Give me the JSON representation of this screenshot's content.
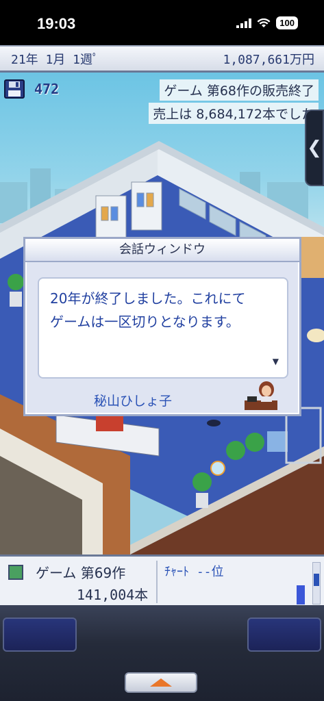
{
  "status_bar": {
    "time": "19:03",
    "battery": "100"
  },
  "info_bar": {
    "date": "21年 1月 1週ﾟ",
    "money": "1,087,661万円"
  },
  "save": {
    "icon": "floppy-disk-icon",
    "count": "472"
  },
  "news": {
    "line1": "ゲーム 第68作の販売終了",
    "line2": "売上は 8,684,172本でした"
  },
  "dialog": {
    "title": "会話ウィンドウ",
    "message_line1": "20年が終了しました。これにて",
    "message_line2": "ゲームは一区切りとなります。",
    "speaker": "秘山ひしょ子"
  },
  "bottom_panel": {
    "game_name": "ゲーム 第69作",
    "sales": "141,004本",
    "chart_rank": "ﾁｬｰﾄ --位"
  },
  "colors": {
    "accent_blue": "#2a52b6",
    "menu_arrow": "#e9762a"
  }
}
